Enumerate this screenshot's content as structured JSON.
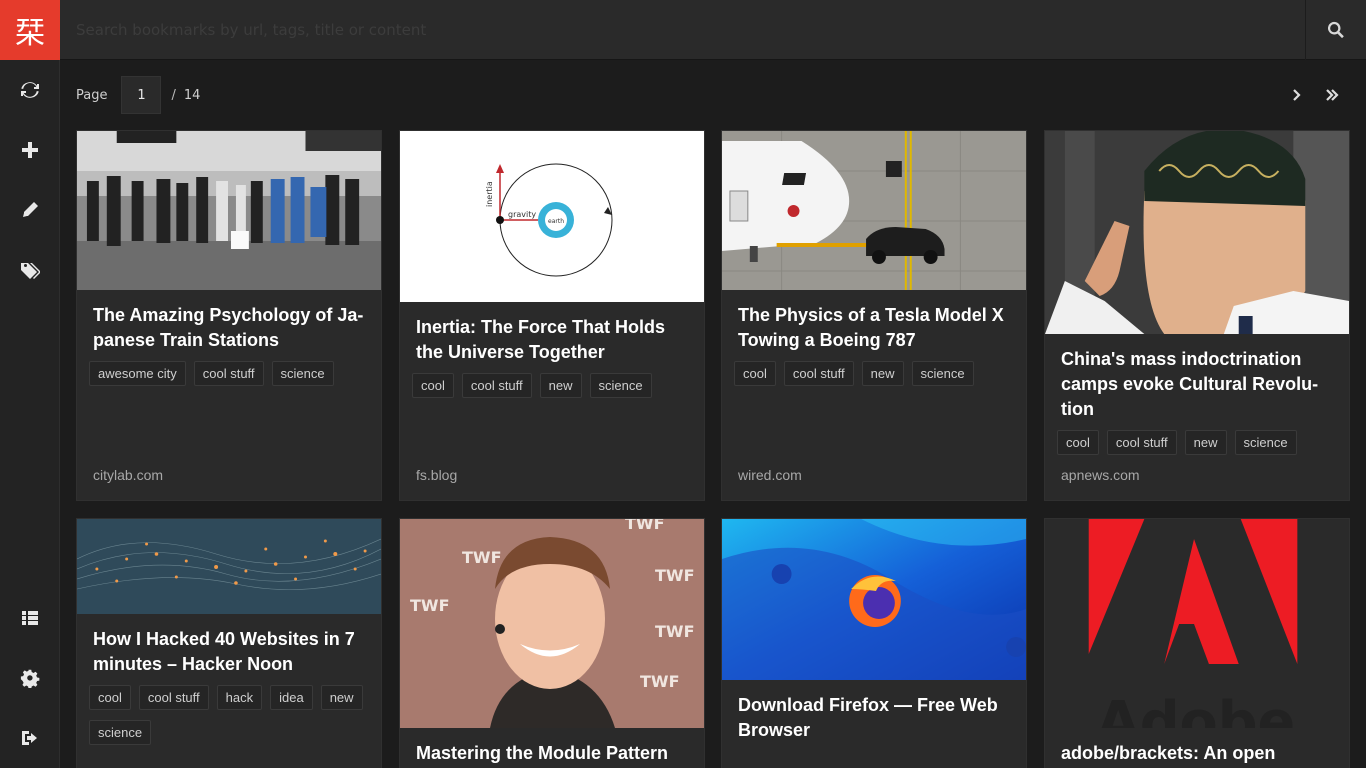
{
  "logo": {
    "glyph": "栞"
  },
  "search": {
    "placeholder": "Search bookmarks by url, tags, title or content"
  },
  "sidebar": {
    "items": [
      {
        "name": "refresh",
        "icon": "refresh-icon"
      },
      {
        "name": "add",
        "icon": "plus-icon"
      },
      {
        "name": "edit",
        "icon": "pencil-icon"
      },
      {
        "name": "tags",
        "icon": "tags-icon"
      },
      {
        "name": "list",
        "icon": "list-icon"
      },
      {
        "name": "settings",
        "icon": "gear-icon"
      },
      {
        "name": "logout",
        "icon": "sign-out-icon"
      }
    ]
  },
  "pagination": {
    "label": "Page",
    "current": "1",
    "separator": "/",
    "total": "14"
  },
  "bookmarks": [
    {
      "title": "The Amazing Psychology of Ja-panese Train Stations",
      "tags": [
        "awesome city",
        "cool stuff",
        "science"
      ],
      "domain": "citylab.com"
    },
    {
      "title": "Inertia: The Force That Holds the Universe Together",
      "tags": [
        "cool",
        "cool stuff",
        "new",
        "science"
      ],
      "domain": "fs.blog",
      "image_text": {
        "inertia": "inertia",
        "gravity": "gravity",
        "earth": "earth"
      }
    },
    {
      "title": "The Physics of a Tesla Model X Towing a Boeing 787",
      "tags": [
        "cool",
        "cool stuff",
        "new",
        "science"
      ],
      "domain": "wired.com"
    },
    {
      "title": "China's mass indoctrination camps evoke Cultural Revolu-tion",
      "tags": [
        "cool",
        "cool stuff",
        "new",
        "science"
      ],
      "domain": "apnews.com"
    },
    {
      "title": "How I Hacked 40 Websites in 7 minutes – Hacker Noon",
      "tags": [
        "cool",
        "cool stuff",
        "hack",
        "idea",
        "new",
        "science"
      ]
    },
    {
      "title": "Mastering the Module Pattern",
      "tags": [],
      "image_text": {
        "brand": "TWF"
      }
    },
    {
      "title": "Download Firefox — Free Web Browser",
      "tags": []
    },
    {
      "title": "adobe/brackets: An open source",
      "tags": [],
      "image_text": {
        "brand": "Adobe"
      }
    }
  ],
  "colors": {
    "accent": "#e53b2c",
    "background": "#1c1c1c",
    "card": "#2a2a2a"
  }
}
